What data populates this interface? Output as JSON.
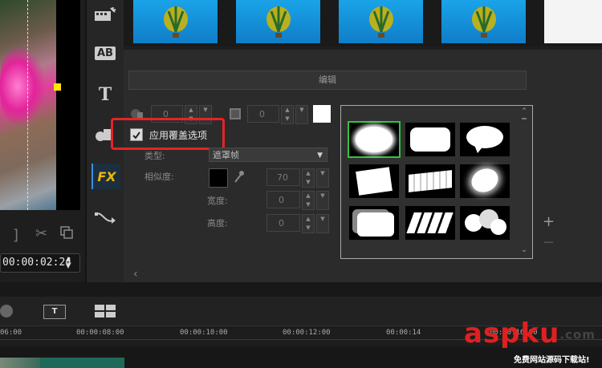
{
  "preview": {
    "timecode": "00:00:02:24"
  },
  "panel": {
    "section_label": "编辑",
    "overlay_label": "应用覆盖选项",
    "overlay_checked": true,
    "type_label": "类型:",
    "type_value": "遮罩帧",
    "similarity_label": "相似度:",
    "width_label": "宽度:",
    "height_label": "高度:",
    "border_value": "0",
    "border2_value": "0",
    "similarity_value": "70",
    "width_value": "0",
    "height_value": "0"
  },
  "sidebar": {
    "tools": [
      "media-fx",
      "title-ab",
      "text",
      "graphics",
      "fx-filter",
      "motion-path"
    ],
    "fx_label": "FX",
    "ab_label": "AB"
  },
  "timeline": {
    "ticks": [
      "06:00",
      "00:00:08:00",
      "00:00:10:00",
      "00:00:12:00",
      "00:00:14",
      "00:00:16:00"
    ]
  },
  "plus_minus": {
    "plus": "+",
    "minus": "−"
  },
  "watermark": {
    "brand": "aspku",
    "suffix": ".com",
    "subtitle": "免费网站源码下载站!"
  },
  "colors": {
    "highlight": "#e52328",
    "selected_mask": "#33c53b",
    "watermark": "#e02020"
  }
}
